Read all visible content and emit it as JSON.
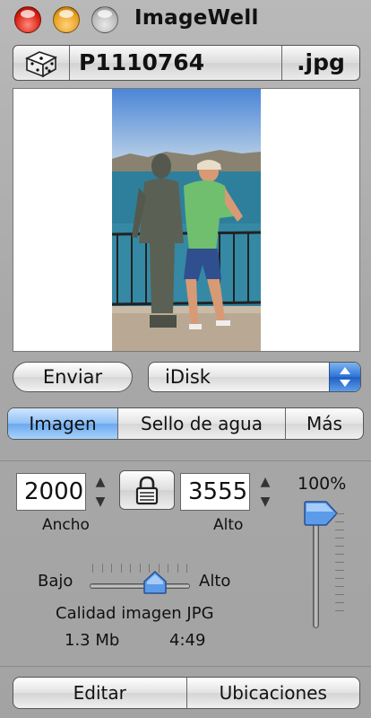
{
  "window": {
    "title": "ImageWell"
  },
  "file": {
    "name": "P1110764",
    "extension": ".jpg"
  },
  "actions": {
    "send_label": "Enviar",
    "destination_selected": "iDisk"
  },
  "tabs": [
    {
      "label": "Imagen",
      "active": true
    },
    {
      "label": "Sello de agua",
      "active": false
    },
    {
      "label": "Más",
      "active": false
    }
  ],
  "size": {
    "width_value": "2000",
    "width_label": "Ancho",
    "height_value": "3555",
    "height_label": "Alto",
    "scale": "100%"
  },
  "quality": {
    "low_label": "Bajo",
    "high_label": "Alto",
    "caption": "Calidad imagen JPG",
    "level": 0.65,
    "file_size": "1.3 Mb",
    "time": "4:49"
  },
  "bottom": {
    "edit_label": "Editar",
    "locations_label": "Ubicaciones"
  },
  "icons": {
    "random": "dice-icon",
    "lock": "lock-icon",
    "popup": "updown-arrows-icon"
  },
  "colors": {
    "accent": "#4d8fe6",
    "active_tab": "#8fc0f5"
  }
}
